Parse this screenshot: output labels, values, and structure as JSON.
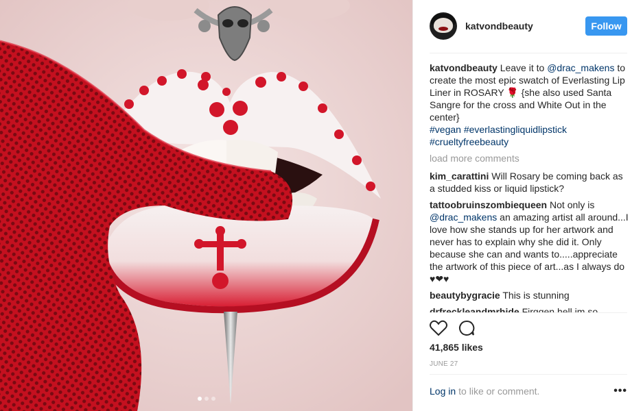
{
  "post": {
    "author": {
      "username": "katvondbeauty",
      "follow_label": "Follow"
    },
    "caption": {
      "username": "katvondbeauty",
      "parts": {
        "a": "Leave it to ",
        "mention": "@drac_makens",
        "b": " to create the most epic swatch of Everlasting Lip Liner in ROSARY 🌹 {she also used Santa Sangre for the cross and White Out in the center}",
        "tag1": "#vegan",
        "tag2": "#everlastingliquidlipstick",
        "tag3": "#crueltyfreebeauty"
      }
    },
    "load_more": "load more comments",
    "comments": [
      {
        "username": "kim_carattini",
        "text": "Will Rosary be coming back as a studded kiss or liquid lipstick?"
      },
      {
        "username": "tattoobruinszombiequeen",
        "text_a": "Not only is ",
        "mention": "@drac_makens",
        "text_b": " an amazing artist all around...I love how she stands up for her artwork and never has to explain why she did it. Only because she can and wants to.....appreciate the artwork of this piece of art...as I always do ♥❤♥"
      },
      {
        "username": "beautybygracie",
        "text": "This is stunning"
      },
      {
        "username": "drfreckleandmrhide",
        "text": "Firggen hell im so"
      }
    ],
    "likes": "41,865 likes",
    "date": "JUNE 27",
    "footer": {
      "login_label": "Log in",
      "login_rest": "to like or comment.",
      "more_label": "•••"
    },
    "carousel": {
      "count": 3,
      "active": 1
    },
    "icons": {
      "like": "heart-outline-icon",
      "comment": "speech-bubble-icon",
      "more": "ellipsis-icon"
    },
    "colors": {
      "accent": "#3897f0",
      "link": "#003569",
      "muted": "#999999",
      "lip_red": "#d2162a"
    }
  }
}
